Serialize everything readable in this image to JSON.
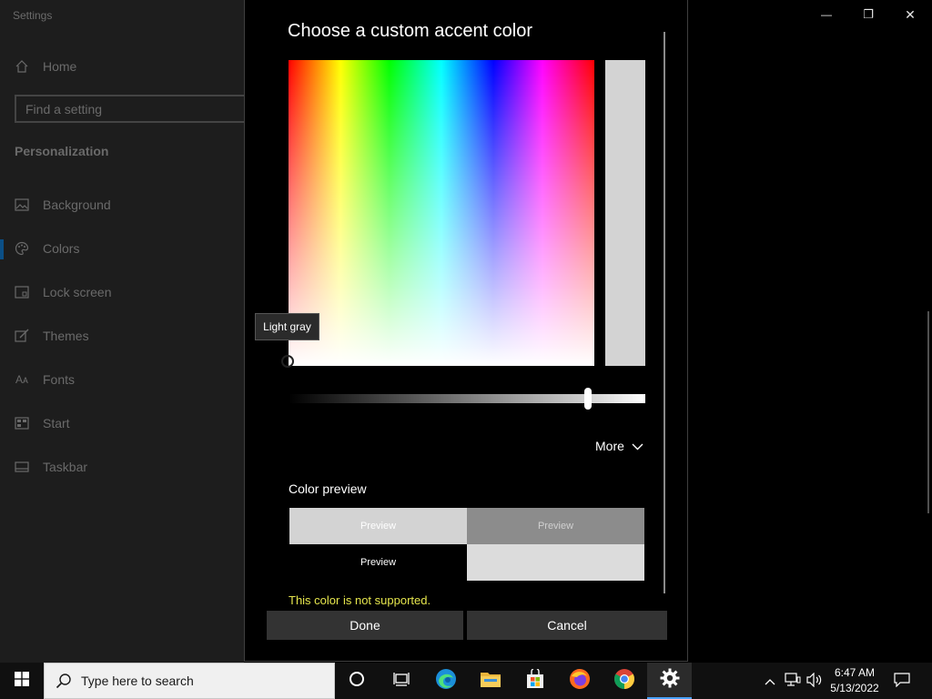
{
  "settings": {
    "app_title": "Settings",
    "home": "Home",
    "search_placeholder": "Find a setting",
    "section": "Personalization",
    "nav": [
      {
        "label": "Background",
        "icon": "image-icon"
      },
      {
        "label": "Colors",
        "icon": "palette-icon"
      },
      {
        "label": "Lock screen",
        "icon": "lock-screen-icon"
      },
      {
        "label": "Themes",
        "icon": "brush-icon"
      },
      {
        "label": "Fonts",
        "icon": "font-icon"
      },
      {
        "label": "Start",
        "icon": "start-icon"
      },
      {
        "label": "Taskbar",
        "icon": "taskbar-icon"
      }
    ],
    "selected_item": "Colors"
  },
  "window_controls": {
    "minimize": "—",
    "maximize": "❐",
    "close": "✕"
  },
  "dialog": {
    "title": "Choose a custom accent color",
    "tooltip": "Light gray",
    "selected_color": "#d3d3d3",
    "brightness_fraction": 0.84,
    "more_label": "More",
    "preview_label": "Color preview",
    "previews": {
      "light": "Preview",
      "mid": "Preview",
      "dark": "Preview"
    },
    "warning": "This color is not supported.",
    "done": "Done",
    "cancel": "Cancel"
  },
  "taskbar": {
    "search_placeholder": "Type here to search",
    "apps": [
      "cortana-icon",
      "task-view-icon",
      "edge-icon",
      "file-explorer-icon",
      "store-icon",
      "firefox-icon",
      "chrome-icon",
      "settings-gear-icon"
    ],
    "time": "6:47 AM",
    "date": "5/13/2022"
  },
  "colors": {
    "warning": "#e6e64d",
    "accent_indicator": "#0b4f86"
  }
}
